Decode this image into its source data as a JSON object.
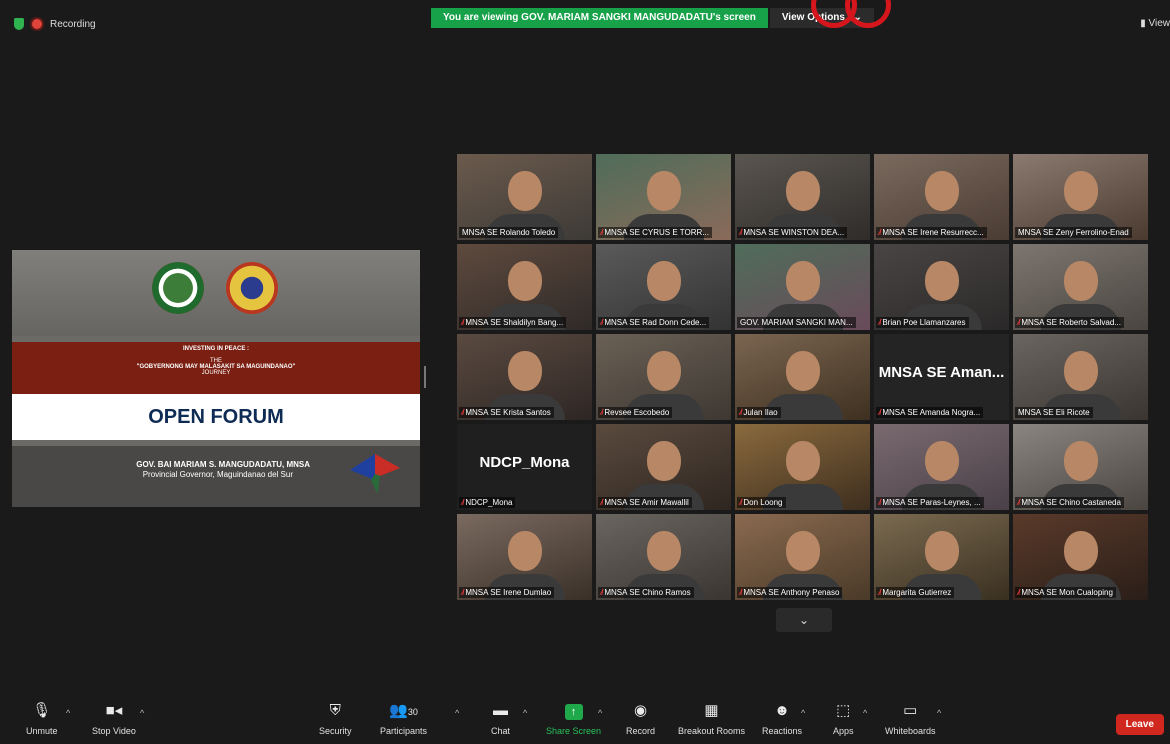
{
  "topbar": {
    "recording_label": "Recording",
    "viewing_banner": "You are viewing GOV. MARIAM SANGKI MANGUDADATU's screen",
    "view_options_label": "View Options",
    "view_label": "View"
  },
  "slide": {
    "subtitle1": "INVESTING IN PEACE :",
    "subtitle2": "THE",
    "subtitle3": "\"GOBYERNONG MAY MALASAKIT SA MAGUINDANAO\"",
    "subtitle4": "JOURNEY",
    "main_title": "OPEN FORUM",
    "presenter_name": "GOV. BAI MARIAM S. MANGUDADATU, MNSA",
    "presenter_role": "Provincial Governor, Maguindanao del Sur"
  },
  "participants": [
    {
      "name": "MNSA SE Rolando Toledo",
      "muted": false,
      "active": true
    },
    {
      "name": "MNSA SE CYRUS E TORR...",
      "muted": true
    },
    {
      "name": "MNSA SE WINSTON DEA...",
      "muted": true
    },
    {
      "name": "MNSA SE Irene Resurrecc...",
      "muted": true
    },
    {
      "name": "MNSA SE Zeny Ferrolino-Enad",
      "muted": false
    },
    {
      "name": "MNSA SE Shaldilyn Bang...",
      "muted": true
    },
    {
      "name": "MNSA SE Rad Donn Cede...",
      "muted": true
    },
    {
      "name": "GOV. MARIAM SANGKI MAN...",
      "muted": false
    },
    {
      "name": "Brian Poe Llamanzares",
      "muted": true
    },
    {
      "name": "MNSA SE Roberto Salvad...",
      "muted": true
    },
    {
      "name": "MNSA SE Krista Santos",
      "muted": true
    },
    {
      "name": "Revsee Escobedo",
      "muted": true
    },
    {
      "name": "Julan Ilao",
      "muted": true
    },
    {
      "name": "MNSA SE Amanda Nogra...",
      "muted": true,
      "big": "MNSA SE Aman..."
    },
    {
      "name": "MNSA SE Eli Ricote",
      "muted": false
    },
    {
      "name": "NDCP_Mona",
      "muted": true,
      "big": "NDCP_Mona"
    },
    {
      "name": "MNSA SE Amir Mawallil",
      "muted": true
    },
    {
      "name": "Don Loong",
      "muted": true
    },
    {
      "name": "MNSA SE Paras-Leynes, ...",
      "muted": true
    },
    {
      "name": "MNSA SE Chino Castaneda",
      "muted": true
    },
    {
      "name": "MNSA SE Irene Dumlao",
      "muted": true
    },
    {
      "name": "MNSA SE Chino Ramos",
      "muted": true
    },
    {
      "name": "MNSA SE Anthony Penaso",
      "muted": true
    },
    {
      "name": "Margarita Gutierrez",
      "muted": true
    },
    {
      "name": "MNSA SE Mon Cualoping",
      "muted": true
    }
  ],
  "toolbar": {
    "unmute": "Unmute",
    "stop_video": "Stop Video",
    "security": "Security",
    "participants": "Participants",
    "participants_count": "30",
    "chat": "Chat",
    "share_screen": "Share Screen",
    "record": "Record",
    "breakout_rooms": "Breakout Rooms",
    "reactions": "Reactions",
    "apps": "Apps",
    "whiteboards": "Whiteboards",
    "leave": "Leave"
  }
}
